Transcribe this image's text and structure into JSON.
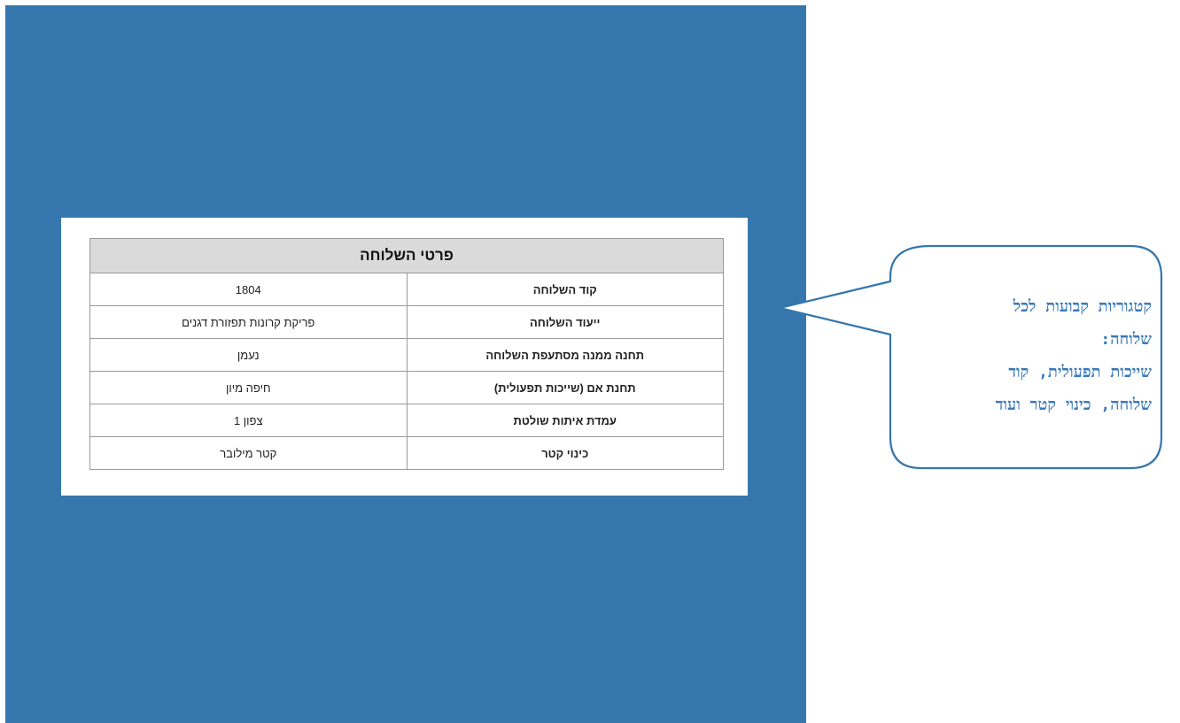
{
  "card": {
    "title": "פרטי השלוחה",
    "rows": [
      {
        "label": "קוד השלוחה",
        "value": "1804"
      },
      {
        "label": "ייעוד השלוחה",
        "value": "פריקת קרונות תפזורת דגנים"
      },
      {
        "label": "תחנה ממנה מסתעפת השלוחה",
        "value": "נעמן"
      },
      {
        "label": "תחנת אם (שייכות תפעולית)",
        "value": "חיפה מיון"
      },
      {
        "label": "עמדת איתות שולטת",
        "value": "צפון 1"
      },
      {
        "label": "כינוי קטר",
        "value": "קטר מילובר"
      }
    ]
  },
  "callout": {
    "lines": [
      "קטגוריות קבועות לכל",
      "שלוחה:",
      "שייכות תפעולית, קוד",
      "שלוחה, כינוי קטר ועוד"
    ],
    "text_color": "#3a7ab8",
    "border_color": "#3577ad"
  },
  "colors": {
    "panel": "#3577ad",
    "table_header": "#dadada"
  }
}
